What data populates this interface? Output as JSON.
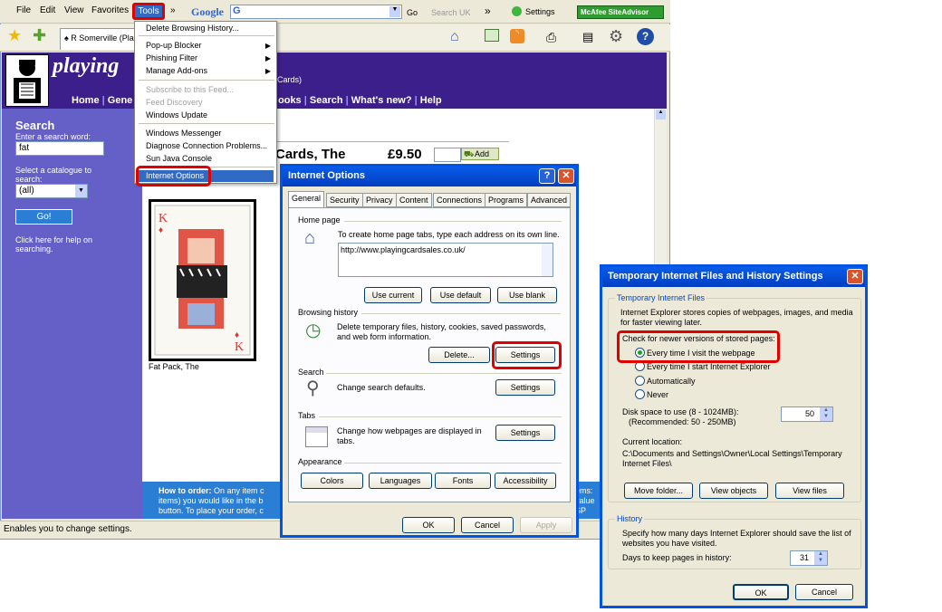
{
  "menu": {
    "file": "File",
    "edit": "Edit",
    "view": "View",
    "favorites": "Favorites",
    "tools": "Tools",
    "chevron": "»"
  },
  "toolbar": {
    "google": "Google",
    "go": "Go",
    "search_uk": "Search UK",
    "settings": "Settings",
    "mcafee": "McAfee SiteAdvisor",
    "tab_label": "R Somerville (Pla"
  },
  "tools_menu": {
    "items": [
      "Delete Browsing History...",
      "Pop-up Blocker",
      "Phishing Filter",
      "Manage Add-ons",
      "Subscribe to this Feed...",
      "Feed Discovery",
      "Windows Update",
      "Windows Messenger",
      "Diagnose Connection Problems...",
      "Sun Java Console",
      "Internet Options"
    ]
  },
  "site": {
    "logo": "playing",
    "subtitle_fragment": "Cards)",
    "nav": [
      "Home",
      "Gene",
      "ooks",
      "Search",
      "What's new?",
      "Help"
    ],
    "search_title": "Search",
    "search_prompt": "Enter a search word:",
    "search_value": "fat",
    "catalogue_prompt": "Select a catalogue to search:",
    "catalogue_value": "(all)",
    "go_button": "Go!",
    "help_text": "Click here for help on searching.",
    "product_title": "Cards, The",
    "price": "£9.50",
    "add_button": "Add",
    "caption": "Fat Pack, The",
    "order_heading": "How to order:",
    "order_text_1": "On any item c",
    "order_text_2": "items) you would like in the b",
    "order_text_3": "button. To place your order, c",
    "order_right_1": "ems:",
    "order_right_2": "value",
    "order_right_3": "SP"
  },
  "status_text": "Enables you to change settings.",
  "internet_options": {
    "title": "Internet Options",
    "tabs": [
      "General",
      "Security",
      "Privacy",
      "Content",
      "Connections",
      "Programs",
      "Advanced"
    ],
    "home_page_label": "Home page",
    "home_page_desc": "To create home page tabs, type each address on its own line.",
    "home_url": "http://www.playingcardsales.co.uk/",
    "use_current": "Use current",
    "use_default": "Use default",
    "use_blank": "Use blank",
    "browsing_history_label": "Browsing history",
    "browsing_history_desc": "Delete temporary files, history, cookies, saved passwords, and web form information.",
    "delete_btn": "Delete...",
    "settings_btn": "Settings",
    "search_label": "Search",
    "search_desc": "Change search defaults.",
    "search_settings": "Settings",
    "tabs_label": "Tabs",
    "tabs_desc": "Change how webpages are displayed in tabs.",
    "tabs_settings": "Settings",
    "appearance_label": "Appearance",
    "colors": "Colors",
    "languages": "Languages",
    "fonts": "Fonts",
    "accessibility": "Accessibility",
    "ok": "OK",
    "cancel": "Cancel",
    "apply": "Apply"
  },
  "tif_dialog": {
    "title": "Temporary Internet Files and History Settings",
    "tif_group": "Temporary Internet Files",
    "tif_desc": "Internet Explorer stores copies of webpages, images, and media for faster viewing later.",
    "check_label": "Check for newer versions of stored pages:",
    "opt1": "Every time I visit the webpage",
    "opt2": "Every time I start Internet Explorer",
    "opt3": "Automatically",
    "opt4": "Never",
    "disk_label": "Disk space to use (8 - 1024MB):",
    "disk_rec": "(Recommended: 50 - 250MB)",
    "disk_value": "50",
    "current_location": "Current location:",
    "location_path": "C:\\Documents and Settings\\Owner\\Local Settings\\Temporary Internet Files\\",
    "move_folder": "Move folder...",
    "view_objects": "View objects",
    "view_files": "View files",
    "history_group": "History",
    "history_desc": "Specify how many days Internet Explorer should save the list of websites you have visited.",
    "days_label": "Days to keep pages in history:",
    "days_value": "31",
    "ok": "OK",
    "cancel": "Cancel"
  },
  "colors": {
    "highlight": "#e00000",
    "title_blue": "#0054e3",
    "site_purple": "#3d1f8b"
  }
}
